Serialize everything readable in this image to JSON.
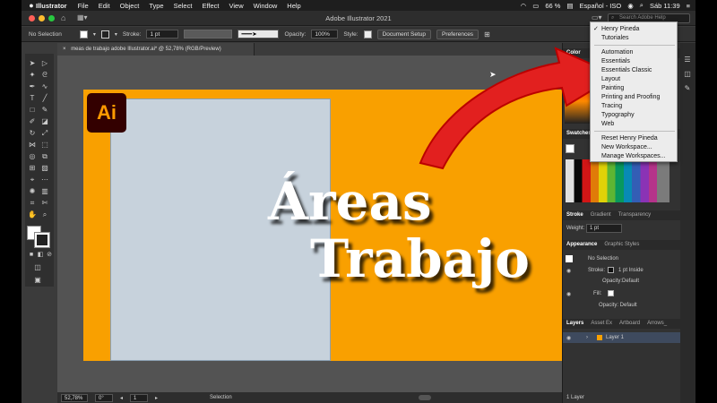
{
  "menubar": {
    "app": "Illustrator",
    "items": [
      "File",
      "Edit",
      "Object",
      "Type",
      "Select",
      "Effect",
      "View",
      "Window",
      "Help"
    ],
    "battery": "66 %",
    "language": "Español - ISO",
    "clock": "Sáb 11:39"
  },
  "window": {
    "title": "Adobe Illustrator 2021",
    "search_placeholder": "Search Adobe Help"
  },
  "control": {
    "selection": "No Selection",
    "stroke_label": "Stroke:",
    "stroke_value": "1 pt",
    "opacity_label": "Opacity:",
    "opacity_value": "100%",
    "style_label": "Style:",
    "doc_setup": "Document Setup",
    "preferences": "Preferences"
  },
  "document": {
    "tab": "meas de trabajo adobe Illustrator.ai* @ 52,78% (RGB/Preview)"
  },
  "artboard": {
    "logo": "Ai",
    "line1": "Áreas",
    "line2": "Trabajo",
    "bg": "#f9a000"
  },
  "status": {
    "zoom": "52,78%",
    "angle": "0°",
    "artboard": "1",
    "tool": "Selection"
  },
  "panels": {
    "color_tab": "Color",
    "swatches_tab": "Swatches",
    "stroke_tabs": [
      "Stroke",
      "Gradient",
      "Transparency"
    ],
    "weight_label": "Weight:",
    "weight_value": "1 pt",
    "appearance_tabs": [
      "Appearance",
      "Graphic Styles"
    ],
    "app_no_selection": "No Selection",
    "app_stroke": "Stroke:",
    "app_stroke_value": "1 pt  Inside",
    "app_opacity": "Opacity:",
    "app_opacity_value": "Default",
    "app_fill": "Fill:",
    "app_opacity2": "Opacity: Default",
    "layers_tabs": [
      "Layers",
      "Asset Ex",
      "Artboard",
      "Arrows_"
    ],
    "layer1": "Layer 1",
    "layer_count": "1 Layer"
  },
  "workspace_menu": {
    "items": [
      "Henry Pineda",
      "Tutoriales",
      "Automation",
      "Essentials",
      "Essentials Classic",
      "Layout",
      "Painting",
      "Printing and Proofing",
      "Tracing",
      "Typography",
      "Web",
      "Reset Henry Pineda",
      "New Workspace...",
      "Manage Workspaces..."
    ],
    "checked": "✓"
  },
  "colors": {
    "accent_red": "#e2201f",
    "artboard": "#f9a000",
    "ui_dark": "#323232"
  }
}
